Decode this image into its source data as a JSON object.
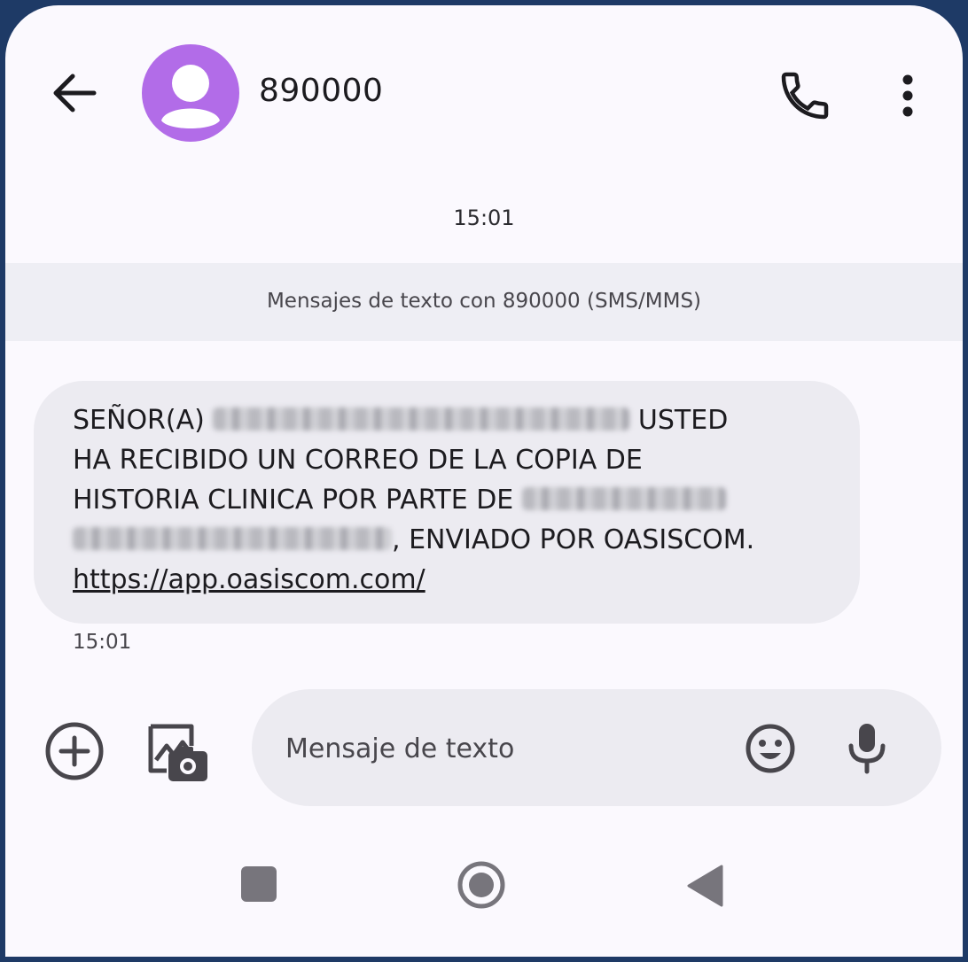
{
  "header": {
    "contact_name": "890000",
    "back_icon": "arrow-back-icon",
    "call_icon": "phone-icon",
    "more_icon": "more-vert-icon",
    "avatar_color": "#b26ce8"
  },
  "conversation": {
    "date_time": "15:01",
    "sms_banner": "Mensajes de texto con 890000 (SMS/MMS)",
    "messages": [
      {
        "line1_start": "SEÑOR(A)",
        "line1_end": "USTED",
        "line2": "HA RECIBIDO UN CORREO DE LA COPIA DE",
        "line3_start": "HISTORIA CLINICA POR PARTE DE",
        "line4_end": ", ENVIADO POR OASISCOM.",
        "link": "https://app.oasiscom.com/",
        "time": "15:01"
      }
    ]
  },
  "composer": {
    "placeholder": "Mensaje de texto",
    "attach_icon": "add-circle-icon",
    "gallery_icon": "gallery-camera-icon",
    "emoji_icon": "emoji-icon",
    "mic_icon": "microphone-icon"
  },
  "navbar": {
    "recents_icon": "square-icon",
    "home_icon": "circle-home-icon",
    "back_icon": "triangle-back-icon"
  }
}
